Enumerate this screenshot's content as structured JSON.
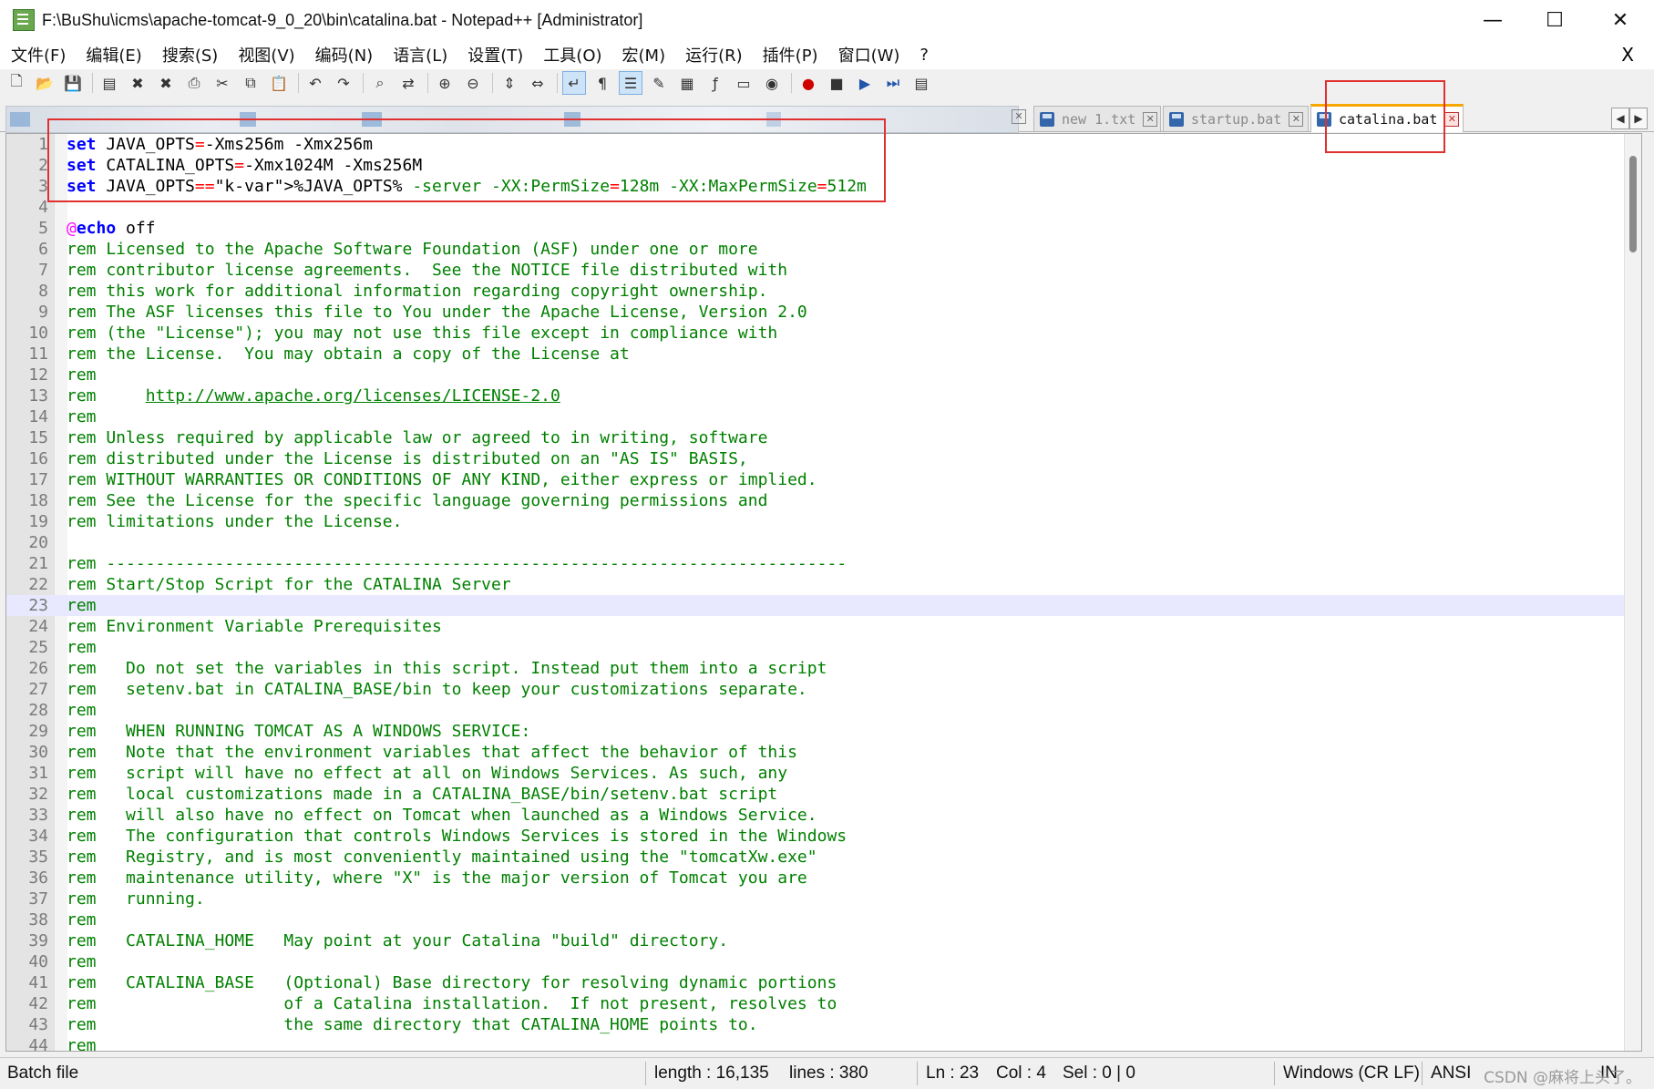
{
  "window": {
    "title": "F:\\BuShu\\icms\\apache-tomcat-9_0_20\\bin\\catalina.bat - Notepad++ [Administrator]",
    "minimize": "—",
    "maximize": "☐",
    "close": "✕"
  },
  "menu": {
    "items": [
      "文件(F)",
      "编辑(E)",
      "搜索(S)",
      "视图(V)",
      "编码(N)",
      "语言(L)",
      "设置(T)",
      "工具(O)",
      "宏(M)",
      "运行(R)",
      "插件(P)",
      "窗口(W)",
      "?"
    ],
    "close": "X"
  },
  "tabs": [
    {
      "label": "new 1.txt",
      "active": false
    },
    {
      "label": "startup.bat",
      "active": false
    },
    {
      "label": "catalina.bat",
      "active": true
    }
  ],
  "tab_close_glyph": "✕",
  "tab_scroll": {
    "left": "◀",
    "right": "▶"
  },
  "editor": {
    "current_line": 23,
    "lines": [
      "set JAVA_OPTS=-Xms256m -Xmx256m",
      "set CATALINA_OPTS=-Xmx1024M -Xms256M",
      "set JAVA_OPTS=%JAVA_OPTS% -server -XX:PermSize=128m -XX:MaxPermSize=512m",
      "",
      "@echo off",
      "rem Licensed to the Apache Software Foundation (ASF) under one or more",
      "rem contributor license agreements.  See the NOTICE file distributed with",
      "rem this work for additional information regarding copyright ownership.",
      "rem The ASF licenses this file to You under the Apache License, Version 2.0",
      "rem (the \"License\"); you may not use this file except in compliance with",
      "rem the License.  You may obtain a copy of the License at",
      "rem",
      "rem     http://www.apache.org/licenses/LICENSE-2.0",
      "rem",
      "rem Unless required by applicable law or agreed to in writing, software",
      "rem distributed under the License is distributed on an \"AS IS\" BASIS,",
      "rem WITHOUT WARRANTIES OR CONDITIONS OF ANY KIND, either express or implied.",
      "rem See the License for the specific language governing permissions and",
      "rem limitations under the License.",
      "",
      "rem ---------------------------------------------------------------------------",
      "rem Start/Stop Script for the CATALINA Server",
      "rem",
      "rem Environment Variable Prerequisites",
      "rem",
      "rem   Do not set the variables in this script. Instead put them into a script",
      "rem   setenv.bat in CATALINA_BASE/bin to keep your customizations separate.",
      "rem",
      "rem   WHEN RUNNING TOMCAT AS A WINDOWS SERVICE:",
      "rem   Note that the environment variables that affect the behavior of this",
      "rem   script will have no effect at all on Windows Services. As such, any",
      "rem   local customizations made in a CATALINA_BASE/bin/setenv.bat script",
      "rem   will also have no effect on Tomcat when launched as a Windows Service.",
      "rem   The configuration that controls Windows Services is stored in the Windows",
      "rem   Registry, and is most conveniently maintained using the \"tomcatXw.exe\"",
      "rem   maintenance utility, where \"X\" is the major version of Tomcat you are",
      "rem   running.",
      "rem",
      "rem   CATALINA_HOME   May point at your Catalina \"build\" directory.",
      "rem",
      "rem   CATALINA_BASE   (Optional) Base directory for resolving dynamic portions",
      "rem                   of a Catalina installation.  If not present, resolves to",
      "rem                   the same directory that CATALINA_HOME points to.",
      "rem"
    ]
  },
  "status": {
    "file_type": "Batch file",
    "length": "length : 16,135",
    "lines": "lines : 380",
    "ln": "Ln : 23",
    "col": "Col : 4",
    "sel": "Sel : 0 | 0",
    "eol": "Windows (CR LF)",
    "encoding": "ANSI",
    "mode": "IN",
    "watermark": "CSDN @麻将上头了。"
  },
  "colors": {
    "keyword": "#0000ff",
    "comment": "#008000",
    "operator": "#ff0000",
    "variable": "#ff8000",
    "at_sign": "#ff00ff",
    "highlight_box": "#e03030",
    "current_line_bg": "#e8e8ff"
  },
  "toolbar_icons": [
    "new-file-icon",
    "open-file-icon",
    "save-icon",
    "save-all-icon",
    "close-icon",
    "close-all-icon",
    "print-icon",
    "cut-icon",
    "copy-icon",
    "paste-icon",
    "undo-icon",
    "redo-icon",
    "find-icon",
    "replace-icon",
    "zoom-in-icon",
    "zoom-out-icon",
    "sync-v-icon",
    "sync-h-icon",
    "word-wrap-icon",
    "show-all-chars-icon",
    "indent-guide-icon",
    "user-lang-icon",
    "doc-map-icon",
    "function-list-icon",
    "folder-workspace-icon",
    "monitor-icon",
    "record-macro-icon",
    "stop-record-icon",
    "play-macro-icon",
    "run-macro-multi-icon",
    "save-macro-icon"
  ]
}
